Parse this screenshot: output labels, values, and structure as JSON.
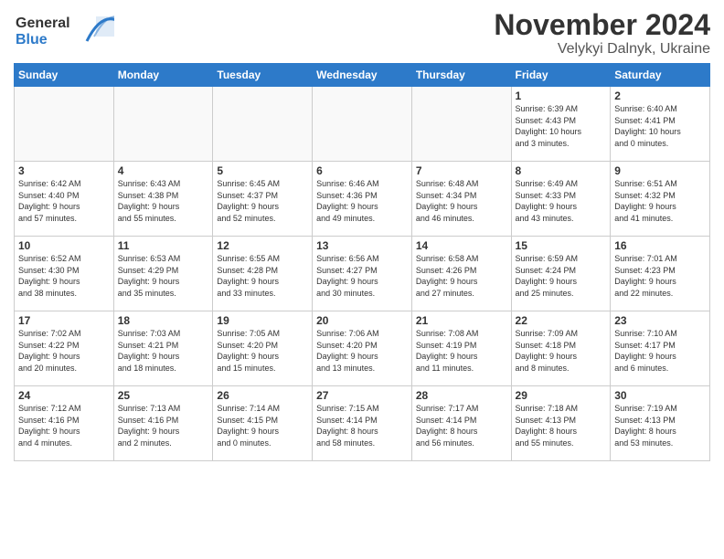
{
  "header": {
    "logo_line1": "General",
    "logo_line2": "Blue",
    "month_title": "November 2024",
    "location": "Velykyi Dalnyk, Ukraine"
  },
  "weekdays": [
    "Sunday",
    "Monday",
    "Tuesday",
    "Wednesday",
    "Thursday",
    "Friday",
    "Saturday"
  ],
  "weeks": [
    [
      {
        "day": "",
        "info": ""
      },
      {
        "day": "",
        "info": ""
      },
      {
        "day": "",
        "info": ""
      },
      {
        "day": "",
        "info": ""
      },
      {
        "day": "",
        "info": ""
      },
      {
        "day": "1",
        "info": "Sunrise: 6:39 AM\nSunset: 4:43 PM\nDaylight: 10 hours\nand 3 minutes."
      },
      {
        "day": "2",
        "info": "Sunrise: 6:40 AM\nSunset: 4:41 PM\nDaylight: 10 hours\nand 0 minutes."
      }
    ],
    [
      {
        "day": "3",
        "info": "Sunrise: 6:42 AM\nSunset: 4:40 PM\nDaylight: 9 hours\nand 57 minutes."
      },
      {
        "day": "4",
        "info": "Sunrise: 6:43 AM\nSunset: 4:38 PM\nDaylight: 9 hours\nand 55 minutes."
      },
      {
        "day": "5",
        "info": "Sunrise: 6:45 AM\nSunset: 4:37 PM\nDaylight: 9 hours\nand 52 minutes."
      },
      {
        "day": "6",
        "info": "Sunrise: 6:46 AM\nSunset: 4:36 PM\nDaylight: 9 hours\nand 49 minutes."
      },
      {
        "day": "7",
        "info": "Sunrise: 6:48 AM\nSunset: 4:34 PM\nDaylight: 9 hours\nand 46 minutes."
      },
      {
        "day": "8",
        "info": "Sunrise: 6:49 AM\nSunset: 4:33 PM\nDaylight: 9 hours\nand 43 minutes."
      },
      {
        "day": "9",
        "info": "Sunrise: 6:51 AM\nSunset: 4:32 PM\nDaylight: 9 hours\nand 41 minutes."
      }
    ],
    [
      {
        "day": "10",
        "info": "Sunrise: 6:52 AM\nSunset: 4:30 PM\nDaylight: 9 hours\nand 38 minutes."
      },
      {
        "day": "11",
        "info": "Sunrise: 6:53 AM\nSunset: 4:29 PM\nDaylight: 9 hours\nand 35 minutes."
      },
      {
        "day": "12",
        "info": "Sunrise: 6:55 AM\nSunset: 4:28 PM\nDaylight: 9 hours\nand 33 minutes."
      },
      {
        "day": "13",
        "info": "Sunrise: 6:56 AM\nSunset: 4:27 PM\nDaylight: 9 hours\nand 30 minutes."
      },
      {
        "day": "14",
        "info": "Sunrise: 6:58 AM\nSunset: 4:26 PM\nDaylight: 9 hours\nand 27 minutes."
      },
      {
        "day": "15",
        "info": "Sunrise: 6:59 AM\nSunset: 4:24 PM\nDaylight: 9 hours\nand 25 minutes."
      },
      {
        "day": "16",
        "info": "Sunrise: 7:01 AM\nSunset: 4:23 PM\nDaylight: 9 hours\nand 22 minutes."
      }
    ],
    [
      {
        "day": "17",
        "info": "Sunrise: 7:02 AM\nSunset: 4:22 PM\nDaylight: 9 hours\nand 20 minutes."
      },
      {
        "day": "18",
        "info": "Sunrise: 7:03 AM\nSunset: 4:21 PM\nDaylight: 9 hours\nand 18 minutes."
      },
      {
        "day": "19",
        "info": "Sunrise: 7:05 AM\nSunset: 4:20 PM\nDaylight: 9 hours\nand 15 minutes."
      },
      {
        "day": "20",
        "info": "Sunrise: 7:06 AM\nSunset: 4:20 PM\nDaylight: 9 hours\nand 13 minutes."
      },
      {
        "day": "21",
        "info": "Sunrise: 7:08 AM\nSunset: 4:19 PM\nDaylight: 9 hours\nand 11 minutes."
      },
      {
        "day": "22",
        "info": "Sunrise: 7:09 AM\nSunset: 4:18 PM\nDaylight: 9 hours\nand 8 minutes."
      },
      {
        "day": "23",
        "info": "Sunrise: 7:10 AM\nSunset: 4:17 PM\nDaylight: 9 hours\nand 6 minutes."
      }
    ],
    [
      {
        "day": "24",
        "info": "Sunrise: 7:12 AM\nSunset: 4:16 PM\nDaylight: 9 hours\nand 4 minutes."
      },
      {
        "day": "25",
        "info": "Sunrise: 7:13 AM\nSunset: 4:16 PM\nDaylight: 9 hours\nand 2 minutes."
      },
      {
        "day": "26",
        "info": "Sunrise: 7:14 AM\nSunset: 4:15 PM\nDaylight: 9 hours\nand 0 minutes."
      },
      {
        "day": "27",
        "info": "Sunrise: 7:15 AM\nSunset: 4:14 PM\nDaylight: 8 hours\nand 58 minutes."
      },
      {
        "day": "28",
        "info": "Sunrise: 7:17 AM\nSunset: 4:14 PM\nDaylight: 8 hours\nand 56 minutes."
      },
      {
        "day": "29",
        "info": "Sunrise: 7:18 AM\nSunset: 4:13 PM\nDaylight: 8 hours\nand 55 minutes."
      },
      {
        "day": "30",
        "info": "Sunrise: 7:19 AM\nSunset: 4:13 PM\nDaylight: 8 hours\nand 53 minutes."
      }
    ]
  ]
}
